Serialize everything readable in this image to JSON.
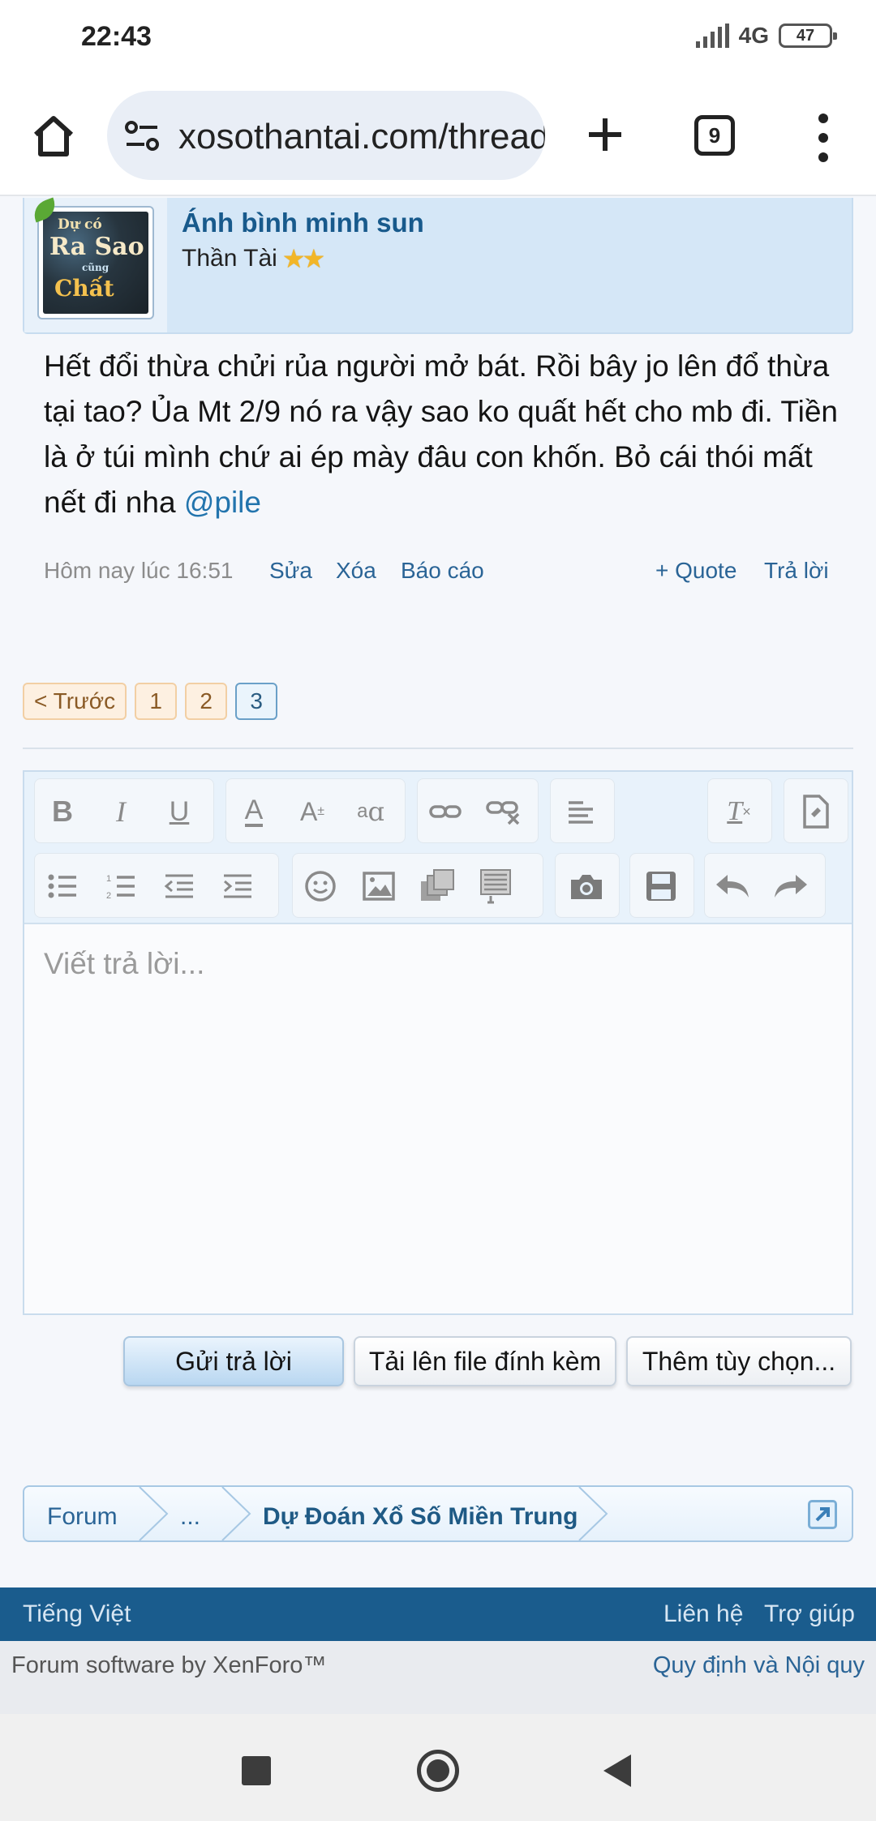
{
  "status_bar": {
    "time": "22:43",
    "network": "4G",
    "battery": "47"
  },
  "browser": {
    "url": "xosothantai.com/threads/",
    "tab_count": "9",
    "icons": [
      "home-icon",
      "site-settings-icon",
      "new-tab-icon",
      "tabs-icon",
      "more-menu-icon"
    ]
  },
  "post": {
    "author_name": "Ánh bình minh sun",
    "author_rank": "Thần Tài",
    "rank_stars": "★★",
    "avatar_words": [
      "Dự có",
      "Ra Sao",
      "cũng",
      "Chất"
    ],
    "body": "Hết đổi thừa chửi rủa người mở bát. Rồi bây jo lên đổ thừa tại tao? Ủa Mt 2/9 nó ra vậy sao ko quất hết cho mb đi. Tiền là ở túi mình chứ ai ép mày đâu con khốn. Bỏ cái thói mất nết đi nha",
    "mention": "@pile",
    "timestamp": "Hôm nay lúc 16:51",
    "actions": {
      "edit": "Sửa",
      "delete": "Xóa",
      "report": "Báo cáo",
      "quote": "+ Quote",
      "reply": "Trả lời"
    }
  },
  "pagination": {
    "prev": "< Trước",
    "pages": [
      "1",
      "2",
      "3"
    ],
    "current": "3"
  },
  "editor": {
    "placeholder": "Viết trả lời...",
    "tools_row1": [
      "bold",
      "italic",
      "underline",
      "font-color",
      "font-size",
      "font-family",
      "link",
      "unlink",
      "align",
      "remove-format",
      "switch-mode"
    ],
    "tools_row2": [
      "bullet-list",
      "numbered-list",
      "outdent",
      "indent",
      "smilie",
      "image",
      "media",
      "quote-block",
      "camera",
      "save-draft",
      "undo",
      "redo"
    ],
    "glyphs": {
      "bold": "B",
      "italic": "I",
      "underline": "U",
      "font_color": "A",
      "font_size": "A",
      "font_family": "a",
      "remove_format": "T"
    }
  },
  "buttons": {
    "submit": "Gửi trả lời",
    "upload": "Tải lên file đính kèm",
    "more_options": "Thêm tùy chọn..."
  },
  "breadcrumb": {
    "root": "Forum",
    "ellipsis": "...",
    "current": "Dự Đoán Xổ Số Miền Trung"
  },
  "footer": {
    "language": "Tiếng Việt",
    "contact": "Liên hệ",
    "help": "Trợ giúp",
    "credit": "Forum software by XenForo™",
    "rules": "Quy định và Nội quy"
  },
  "colors": {
    "accent": "#185a8c",
    "footer": "#1a5c8d",
    "link": "#2a6496",
    "header_bg": "#d5e7f7"
  }
}
